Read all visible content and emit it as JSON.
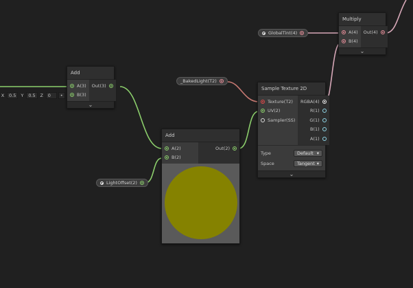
{
  "nodes": {
    "add_left": {
      "title": "Add",
      "inputs": [
        {
          "label": "A(3)"
        },
        {
          "label": "B(3)"
        }
      ],
      "output": "Out(3)",
      "expand_icon": "chevron-down-icon"
    },
    "add_main": {
      "title": "Add",
      "inputs": [
        {
          "label": "A(2)"
        },
        {
          "label": "B(2)"
        }
      ],
      "output": "Out(2)",
      "preview_color": "#858200"
    },
    "sample_texture": {
      "title": "Sample Texture 2D",
      "inputs": [
        {
          "label": "Texture(T2)"
        },
        {
          "label": "UV(2)"
        },
        {
          "label": "Sampler(SS)"
        }
      ],
      "outputs": [
        {
          "label": "RGBA(4)"
        },
        {
          "label": "R(1)"
        },
        {
          "label": "G(1)"
        },
        {
          "label": "B(1)"
        },
        {
          "label": "A(1)"
        }
      ],
      "settings": [
        {
          "key": "Type",
          "value": "Default"
        },
        {
          "key": "Space",
          "value": "Tangent"
        }
      ],
      "expand_icon": "chevron-down-icon"
    },
    "multiply": {
      "title": "Multiply",
      "inputs": [
        {
          "label": "A(4)"
        },
        {
          "label": "B(4)"
        }
      ],
      "output": "Out(4)",
      "expand_icon": "chevron-down-icon"
    }
  },
  "properties": {
    "baked_light": "_BakedLight(T2)",
    "global_tint": "GlobalTint(4)",
    "light_offset": "LightOffset(2)"
  },
  "inline_vector": {
    "x_label": "X",
    "x_value": "0.5",
    "y_label": "Y",
    "y_value": "0.5",
    "z_label": "Z",
    "z_value": "0"
  },
  "colors": {
    "wire_vector": "#8ccf6c",
    "wire_texture": "#c97a73",
    "wire_color": "#d7a8b8",
    "background": "#202020"
  }
}
